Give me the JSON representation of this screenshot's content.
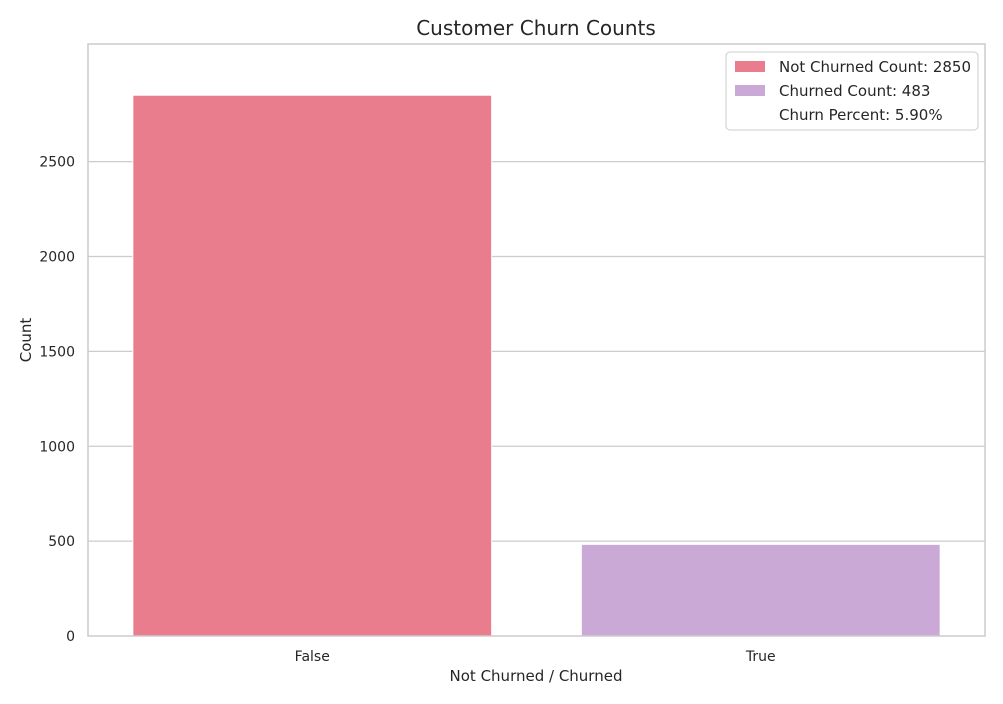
{
  "chart_data": {
    "type": "bar",
    "title": "Customer Churn Counts",
    "xlabel": "Not Churned / Churned",
    "ylabel": "Count",
    "categories": [
      "False",
      "True"
    ],
    "values": [
      2850,
      483
    ],
    "colors": [
      "#ea7d8d",
      "#cba9d6"
    ],
    "ylim": [
      0,
      3120
    ],
    "yticks": [
      0,
      500,
      1000,
      1500,
      2000,
      2500
    ],
    "grid": true,
    "legend": {
      "placement": "top-right",
      "entries": [
        {
          "label": "Not Churned Count: 2850",
          "color": "#ea7d8d"
        },
        {
          "label": "Churned Count: 483",
          "color": "#cba9d6"
        },
        {
          "label": "Churn Percent: 5.90%",
          "color": null
        }
      ]
    }
  }
}
